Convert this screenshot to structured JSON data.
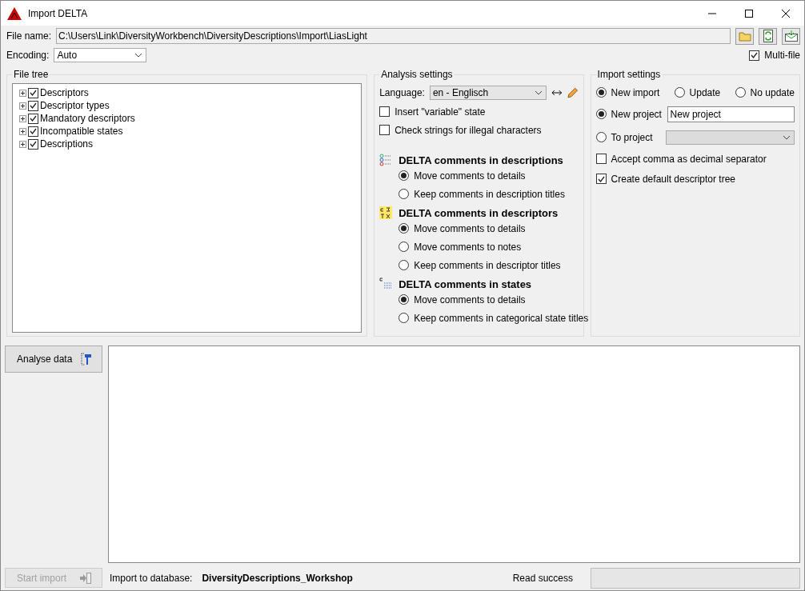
{
  "window": {
    "title": "Import DELTA"
  },
  "file_name": {
    "label": "File name:",
    "value": "C:\\Users\\Link\\DiversityWorkbench\\DiversityDescriptions\\Import\\LiasLight"
  },
  "encoding": {
    "label": "Encoding:",
    "value": "Auto"
  },
  "multi_file": {
    "label": "Multi-file",
    "checked": true
  },
  "file_tree": {
    "title": "File tree",
    "items": [
      {
        "label": "Descriptors",
        "checked": true,
        "expanded": false
      },
      {
        "label": "Descriptor types",
        "checked": true,
        "expanded": false
      },
      {
        "label": "Mandatory descriptors",
        "checked": true,
        "expanded": false
      },
      {
        "label": "Incompatible states",
        "checked": true,
        "expanded": false
      },
      {
        "label": "Descriptions",
        "checked": true,
        "expanded": false
      }
    ]
  },
  "analysis": {
    "title": "Analysis settings",
    "language": {
      "label": "Language:",
      "value": "en - Englisch"
    },
    "options": [
      {
        "label": "Insert \"variable\" state",
        "checked": false
      },
      {
        "label": "Check strings for illegal characters",
        "checked": false
      }
    ],
    "sections": [
      {
        "kind": "descriptions",
        "title": "DELTA comments in descriptions",
        "options": [
          {
            "label": "Move comments to details",
            "selected": true
          },
          {
            "label": "Keep comments in description titles",
            "selected": false
          }
        ]
      },
      {
        "kind": "descriptors",
        "title": "DELTA comments in descriptors",
        "options": [
          {
            "label": "Move comments to details",
            "selected": true
          },
          {
            "label": "Move comments to notes",
            "selected": false
          },
          {
            "label": "Keep comments in descriptor titles",
            "selected": false
          }
        ]
      },
      {
        "kind": "states",
        "title": "DELTA comments in states",
        "options": [
          {
            "label": "Move comments to details",
            "selected": true
          },
          {
            "label": "Keep comments in categorical state titles",
            "selected": false
          }
        ]
      }
    ]
  },
  "import_settings": {
    "title": "Import settings",
    "modes": [
      {
        "label": "New import",
        "selected": true
      },
      {
        "label": "Update",
        "selected": false
      },
      {
        "label": "No update",
        "selected": false
      }
    ],
    "targets": [
      {
        "kind": "text",
        "label": "New project",
        "selected": true,
        "value": "New project",
        "disabled": false
      },
      {
        "kind": "dropdown",
        "label": "To project",
        "selected": false,
        "disabled": true
      }
    ],
    "options": [
      {
        "label": "Accept comma as decimal separator",
        "checked": false
      },
      {
        "label": "Create default descriptor tree",
        "checked": true
      }
    ]
  },
  "analyse_button": {
    "label": "Analyse data",
    "disabled": false
  },
  "start_button": {
    "label": "Start import",
    "disabled": true
  },
  "footer": {
    "database_label": "Import to database:",
    "database_name": "DiversityDescriptions_Workshop",
    "read_success": {
      "label": "Read success",
      "level": 0
    }
  }
}
